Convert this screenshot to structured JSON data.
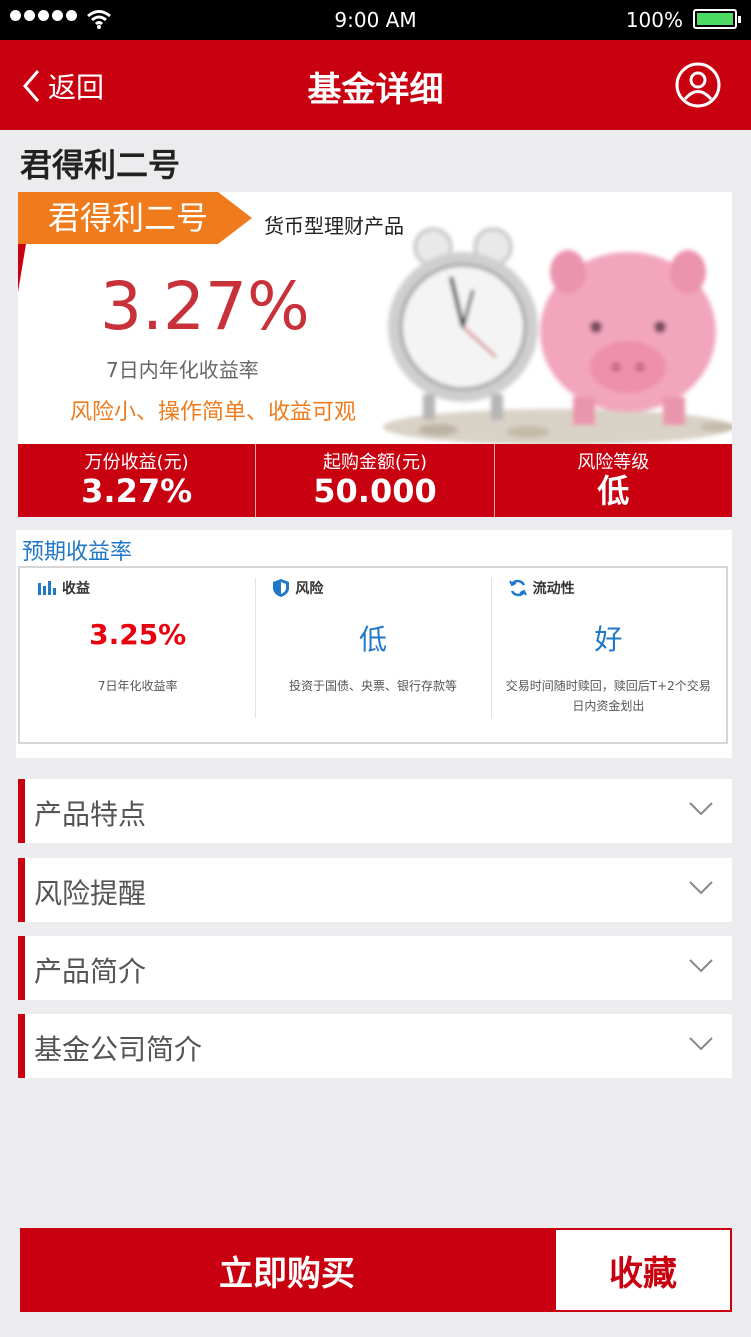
{
  "status_bar": {
    "time": "9:00  AM",
    "battery": "100%"
  },
  "nav": {
    "back_label": "返回",
    "title": "基金详细"
  },
  "product": {
    "name": "君得利二号",
    "tag": "君得利二号",
    "type": "货币型理财产品",
    "rate": "3.27%",
    "rate_label": "7日内年化收益率",
    "slogan": "风险小、操作简单、收益可观"
  },
  "stats": [
    {
      "label": "万份收益(元)",
      "value": "3.27%"
    },
    {
      "label": "起购金额(元)",
      "value": "50.000"
    },
    {
      "label": "风险等级",
      "value": "低"
    }
  ],
  "expected": {
    "heading": "预期收益率",
    "columns": [
      {
        "icon": "bar-chart-icon",
        "title": "收益",
        "value": "3.25%",
        "value_color": "#e8000e",
        "desc": "7日年化收益率"
      },
      {
        "icon": "shield-icon",
        "title": "风险",
        "value": "低",
        "value_color": "#1f78c8",
        "desc": "投资于国债、央票、银行存款等"
      },
      {
        "icon": "refresh-icon",
        "title": "流动性",
        "value": "好",
        "value_color": "#1f78c8",
        "desc": "交易时间随时赎回，赎回后T+2个交易日内资金划出"
      }
    ]
  },
  "accordion": [
    {
      "label": "产品特点"
    },
    {
      "label": "风险提醒"
    },
    {
      "label": "产品简介"
    },
    {
      "label": "基金公司简介"
    }
  ],
  "actions": {
    "buy_label": "立即购买",
    "favorite_label": "收藏"
  },
  "colors": {
    "brand_red": "#c9000f",
    "orange": "#f07b1d",
    "link_blue": "#1f78c8"
  }
}
